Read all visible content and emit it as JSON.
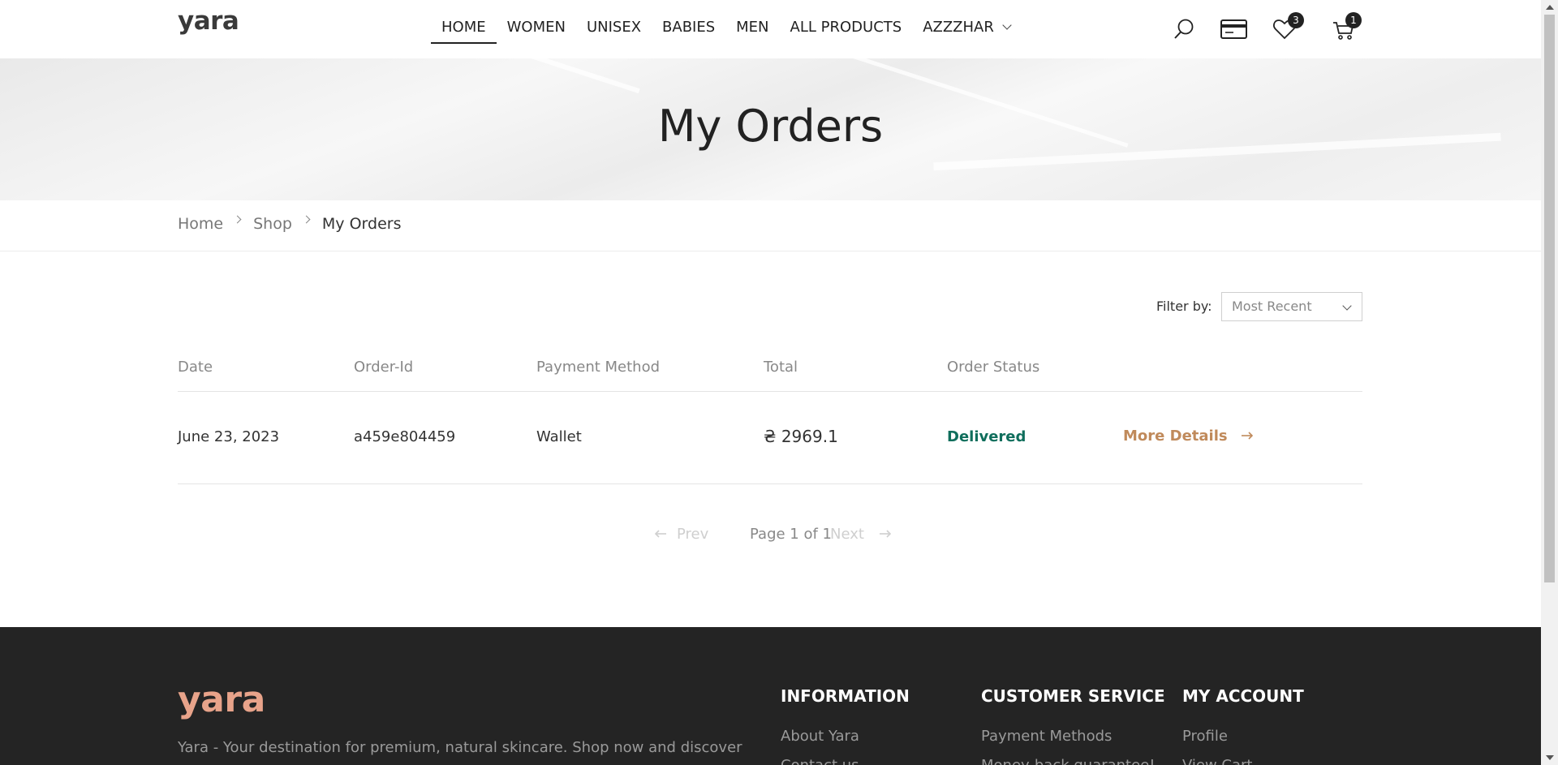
{
  "header": {
    "logo": "yara",
    "nav": [
      "HOME",
      "WOMEN",
      "UNISEX",
      "BABIES",
      "MEN",
      "ALL PRODUCTS",
      "AZZZHAR"
    ],
    "wishlist_count": "3",
    "cart_count": "1",
    "icons": [
      "search-icon",
      "wallet-card-icon",
      "heart-icon",
      "cart-icon"
    ]
  },
  "banner": {
    "title": "My Orders"
  },
  "breadcrumb": {
    "home": "Home",
    "shop": "Shop",
    "current": "My Orders"
  },
  "filter": {
    "label": "Filter by:",
    "selected": "Most Recent"
  },
  "table": {
    "headers": [
      "Date",
      "Order-Id",
      "Payment Method",
      "Total",
      "Order Status"
    ],
    "rows": [
      {
        "date": "June 23, 2023",
        "order_id": "a459e804459",
        "payment": "Wallet",
        "total": "₴ 2969.1",
        "status": "Delivered",
        "action": "More Details"
      }
    ]
  },
  "pagination": {
    "prev": "Prev",
    "info": "Page 1 of 1",
    "next": "Next"
  },
  "footer": {
    "logo": "yara",
    "description": "Yara - Your destination for premium, natural skincare. Shop now and discover",
    "columns": [
      {
        "title": "INFORMATION",
        "links": [
          "About Yara",
          "Contact us"
        ]
      },
      {
        "title": "CUSTOMER SERVICE",
        "links": [
          "Payment Methods",
          "Money-back guarantee!"
        ]
      },
      {
        "title": "MY ACCOUNT",
        "links": [
          "Profile",
          "View Cart"
        ]
      }
    ]
  },
  "colors": {
    "status_delivered": "#0f6e5c",
    "link_accent": "#c08a5b",
    "footer_bg": "#242424",
    "footer_logo": "#e8a38a"
  }
}
